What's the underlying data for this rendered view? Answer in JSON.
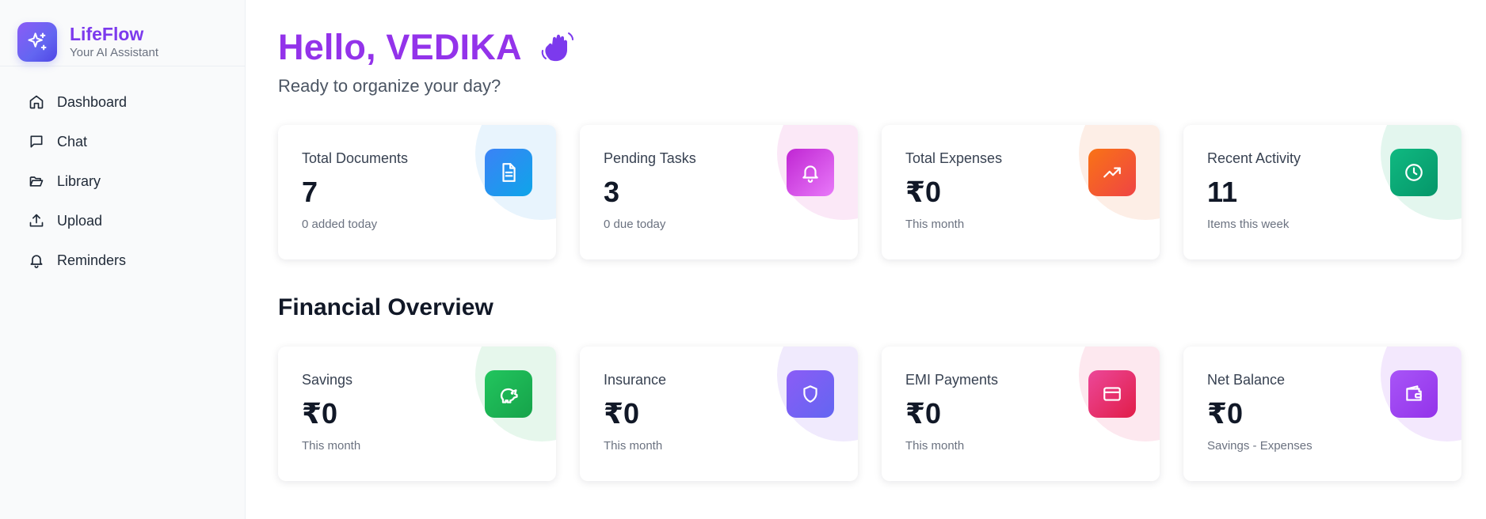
{
  "brand": {
    "name": "LifeFlow",
    "subtitle": "Your AI Assistant",
    "icon": "sparkles-icon"
  },
  "sidebar": {
    "items": [
      {
        "label": "Dashboard",
        "icon": "home-icon"
      },
      {
        "label": "Chat",
        "icon": "chat-bubble-icon"
      },
      {
        "label": "Library",
        "icon": "folder-open-icon"
      },
      {
        "label": "Upload",
        "icon": "upload-icon"
      },
      {
        "label": "Reminders",
        "icon": "bell-icon"
      }
    ]
  },
  "header": {
    "greeting": "Hello, VEDIKA",
    "subtitle": "Ready to organize your day?",
    "greeting_icon": "waving-hand-icon"
  },
  "stats": [
    {
      "title": "Total Documents",
      "value": "7",
      "note": "0 added today",
      "icon": "document-icon",
      "color": "#0ea5e9"
    },
    {
      "title": "Pending Tasks",
      "value": "3",
      "note": "0 due today",
      "icon": "bell-icon",
      "color": "#d946ef"
    },
    {
      "title": "Total Expenses",
      "value": "₹0",
      "note": "This month",
      "icon": "trending-up-icon",
      "color": "#f97316"
    },
    {
      "title": "Recent Activity",
      "value": "11",
      "note": "Items this week",
      "icon": "clock-icon",
      "color": "#10b981"
    }
  ],
  "financial": {
    "title": "Financial Overview",
    "cards": [
      {
        "title": "Savings",
        "value": "₹0",
        "note": "This month",
        "icon": "piggy-bank-icon",
        "color": "#22c55e"
      },
      {
        "title": "Insurance",
        "value": "₹0",
        "note": "This month",
        "icon": "shield-icon",
        "color": "#8b5cf6"
      },
      {
        "title": "EMI Payments",
        "value": "₹0",
        "note": "This month",
        "icon": "credit-card-icon",
        "color": "#ec4899"
      },
      {
        "title": "Net Balance",
        "value": "₹0",
        "note": "Savings - Expenses",
        "icon": "wallet-icon",
        "color": "#a855f7"
      }
    ]
  }
}
